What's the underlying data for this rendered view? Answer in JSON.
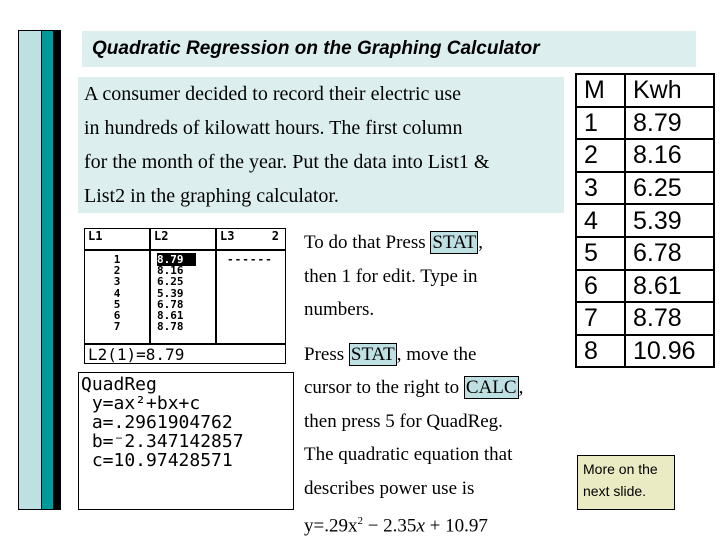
{
  "slide": {
    "title": "Quadratic Regression on the Graphing Calculator",
    "intro_lines": [
      "A consumer decided to record their electric use",
      "in hundreds of kilowatt hours. The first column",
      "for the month of the year.  Put the data into List1 &",
      "List2 in the graphing calculator."
    ]
  },
  "calc_list_screen": {
    "headers": [
      "L1",
      "L2",
      "L3"
    ],
    "header_index": "2",
    "L1": [
      "1",
      "2",
      "3",
      "4",
      "5",
      "6",
      "7"
    ],
    "L2": [
      "8.79",
      "8.16",
      "6.25",
      "5.39",
      "6.78",
      "8.61",
      "8.78"
    ],
    "L3": [
      "------"
    ],
    "footer": "L2(1)=8.79"
  },
  "calc_quadreg_screen": {
    "lines": [
      "QuadReg",
      " y=ax²+bx+c",
      " a=.2961904762",
      " b=⁻2.347142857",
      " c=10.97428571"
    ]
  },
  "steps": {
    "p1_a": "To do that Press ",
    "p1_key": "STAT",
    "p1_b": ",",
    "p1_c": "then 1 for edit. Type in",
    "p1_d": "numbers.",
    "p2_a": "Press ",
    "p2_key": "STAT",
    "p2_b": ", move the",
    "p2_c": "cursor to the right to ",
    "p2_key2": "CALC",
    "p2_d": ",",
    "p2_e": "then press 5 for QuadReg.",
    "p2_f": "The quadratic equation that",
    "p2_g": "describes power use is",
    "eq_a": "y=.29x",
    "eq_sup": "2",
    "eq_b": " − 2.35",
    "eq_x": "x",
    "eq_c": " + 10.97"
  },
  "data_table": {
    "headers": [
      "M",
      "Kwh"
    ],
    "rows": [
      [
        "1",
        "8.79"
      ],
      [
        "2",
        "8.16"
      ],
      [
        "3",
        "6.25"
      ],
      [
        "4",
        "5.39"
      ],
      [
        "5",
        "6.78"
      ],
      [
        "6",
        "8.61"
      ],
      [
        "7",
        "8.78"
      ],
      [
        "8",
        "10.96"
      ]
    ]
  },
  "note": {
    "line1": "More on the",
    "line2": "next slide."
  }
}
